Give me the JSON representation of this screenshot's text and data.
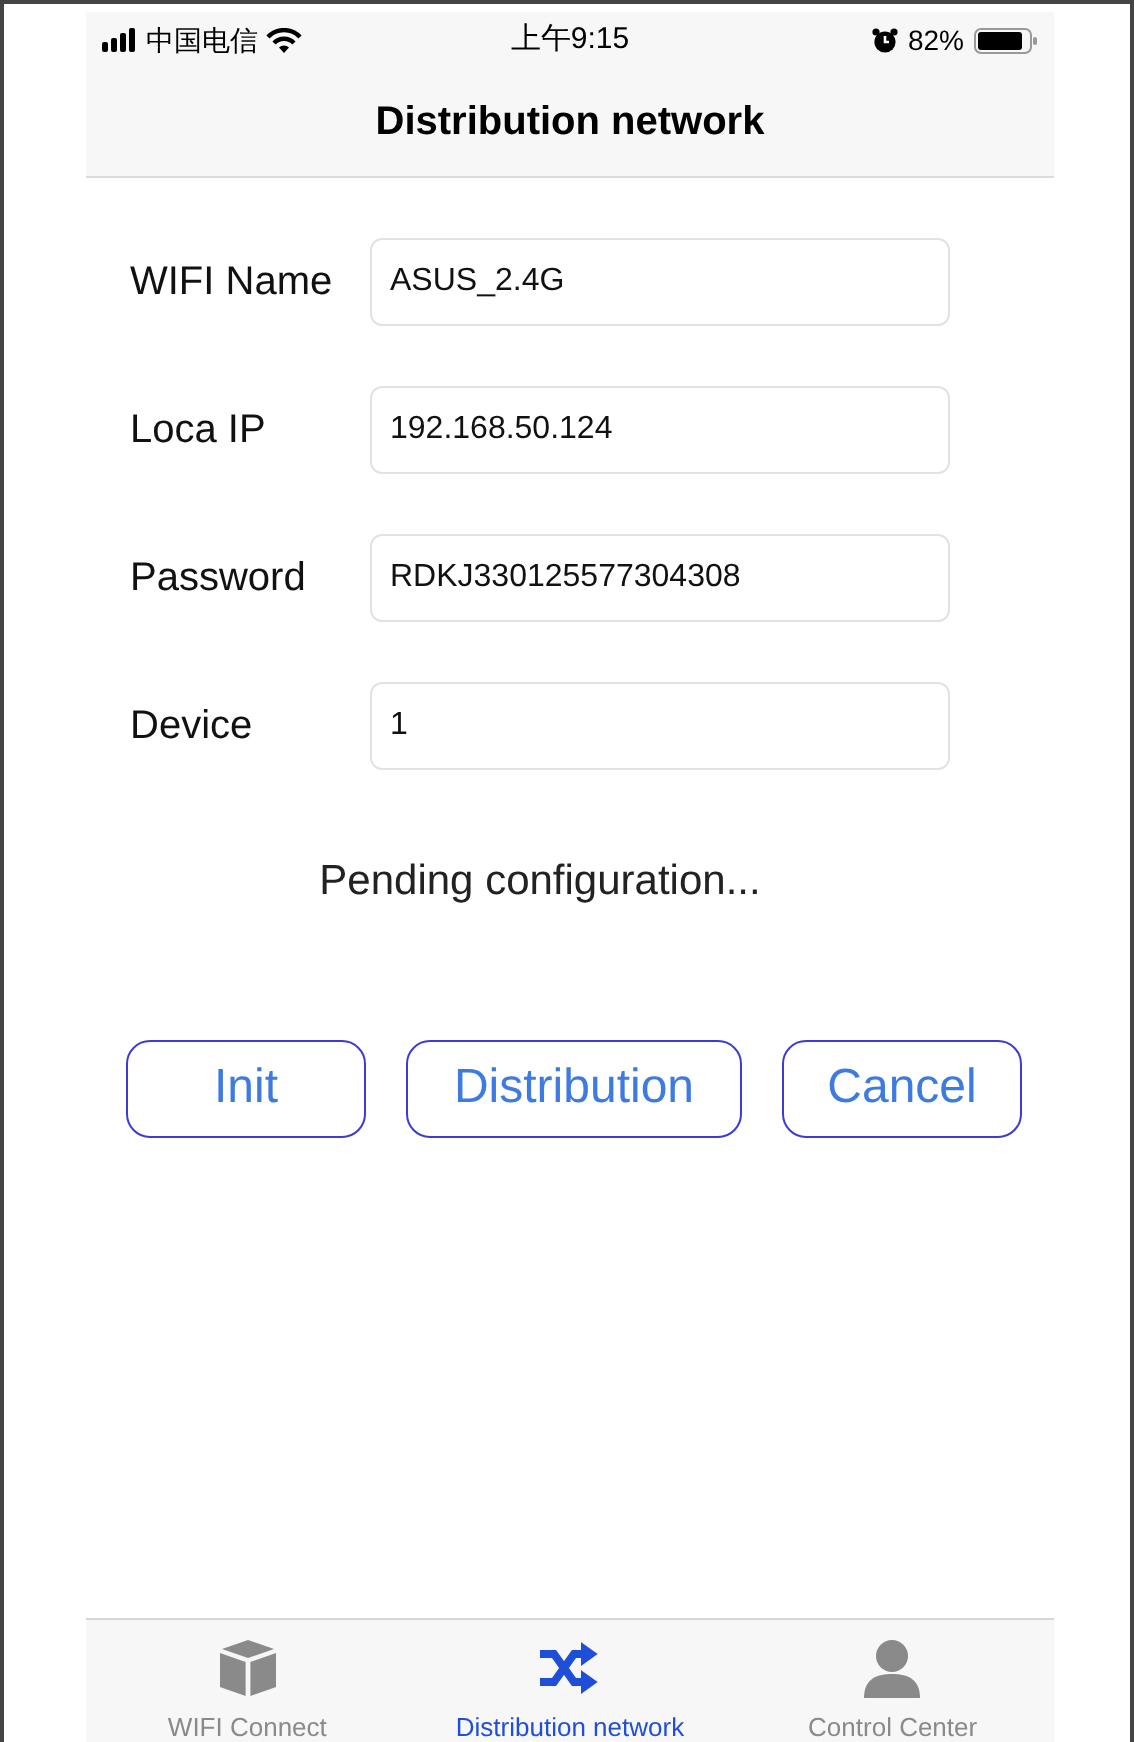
{
  "status_bar": {
    "carrier": "中国电信",
    "time": "上午9:15",
    "battery": "82%"
  },
  "nav": {
    "title": "Distribution network"
  },
  "fields": [
    {
      "label": "WIFI Name",
      "value": "ASUS_2.4G"
    },
    {
      "label": "Loca IP",
      "value": "192.168.50.124"
    },
    {
      "label": "Password",
      "value": "RDKJ330125577304308"
    },
    {
      "label": "Device",
      "value": "1"
    }
  ],
  "status_text": "Pending configuration...",
  "buttons": [
    "Init",
    "Distribution",
    "Cancel"
  ],
  "tabs": [
    {
      "label": "WIFI Connect",
      "kind": "cube",
      "selected": false
    },
    {
      "label": "Distribution network",
      "kind": "shuffle",
      "selected": true
    },
    {
      "label": "Control Center",
      "kind": "person",
      "selected": false
    }
  ]
}
